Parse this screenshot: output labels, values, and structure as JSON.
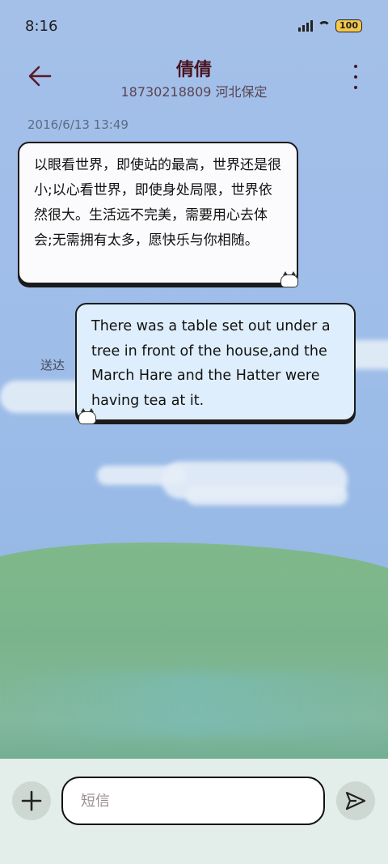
{
  "status": {
    "time": "8:16",
    "battery": "100"
  },
  "header": {
    "title": "倩倩",
    "subtitle": "18730218809 河北保定"
  },
  "conversation": {
    "timestamp": "2016/6/13 13:49",
    "incoming_message": "以眼看世界，即使站的最高，世界还是很小;以心看世界，即使身处局限，世界依然很大。生活远不完美，需要用心去体会;无需拥有太多，愿快乐与你相随。",
    "outgoing_message": "There was a table set out under a tree in front of the house,and the March Hare and the Hatter were having tea at it.",
    "delivery_status": "送达"
  },
  "composer": {
    "placeholder": "短信"
  },
  "icons": {
    "back": "arrow-left-icon",
    "more": "more-vertical-icon",
    "add": "plus-icon",
    "send": "send-icon"
  },
  "colors": {
    "title": "#4a1420",
    "accent": "#5a1a28"
  }
}
